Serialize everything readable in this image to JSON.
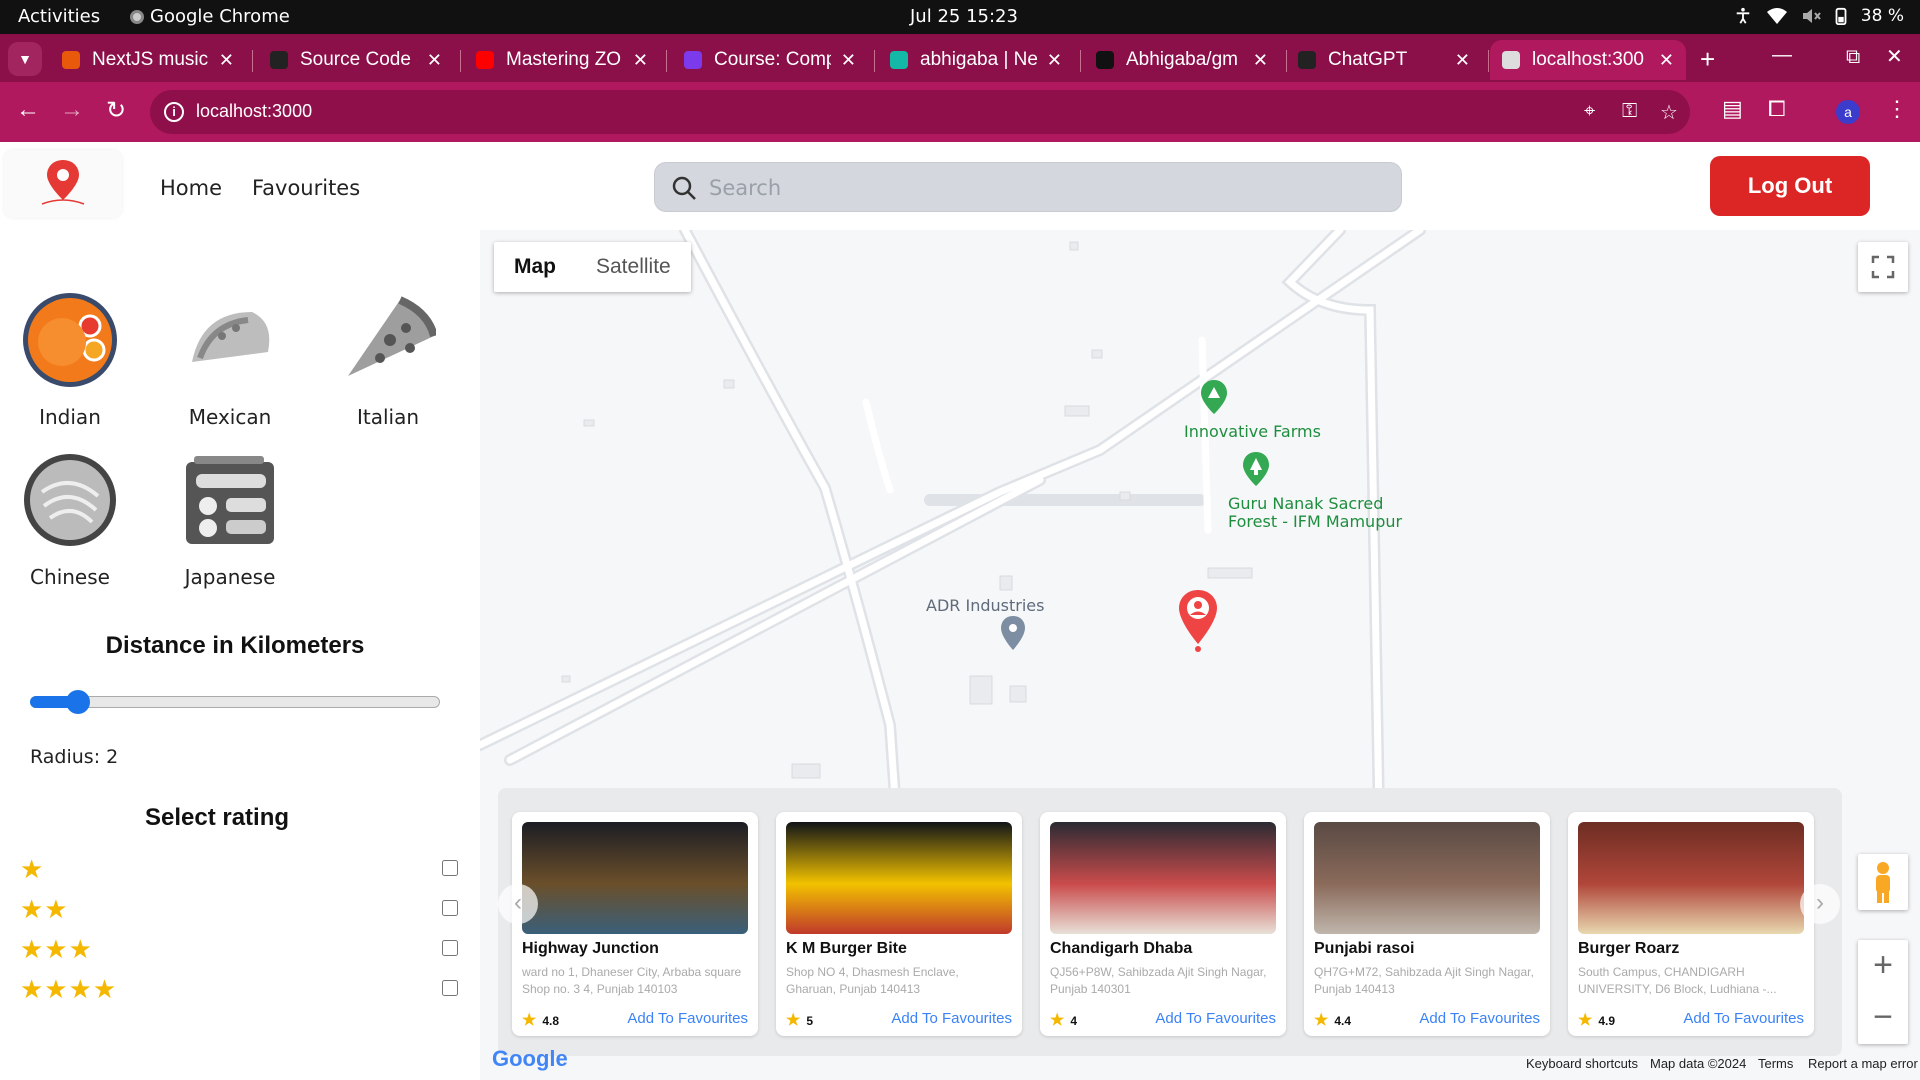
{
  "os": {
    "activities": "Activities",
    "app_name": "Google Chrome",
    "clock": "Jul 25  15:23",
    "battery": "38 %"
  },
  "tabs": [
    {
      "title": "NextJS music",
      "icon_color": "#e8590c"
    },
    {
      "title": "Source Code -",
      "icon_color": "#222222"
    },
    {
      "title": "Mastering ZO",
      "icon_color": "#ff0000"
    },
    {
      "title": "Course: Comp",
      "icon_color": "#7c3aed"
    },
    {
      "title": "abhigaba | Ne",
      "icon_color": "#14b8a6"
    },
    {
      "title": "Abhigaba/gm",
      "icon_color": "#111111"
    },
    {
      "title": "ChatGPT",
      "icon_color": "#222222"
    },
    {
      "title": "localhost:300",
      "icon_color": "#dddddd",
      "active": true
    }
  ],
  "address_bar": {
    "url": "localhost:3000"
  },
  "header": {
    "nav": [
      "Home",
      "Favourites"
    ],
    "search_placeholder": "Search",
    "logout_label": "Log Out"
  },
  "sidebar": {
    "categories": [
      "Indian",
      "Mexican",
      "Italian",
      "Chinese",
      "Japanese"
    ],
    "distance_title": "Distance in Kilometers",
    "radius_label": "Radius: 2",
    "radius_value": 2,
    "rating_title": "Select rating",
    "rating_options": [
      {
        "stars": "★",
        "checked": false
      },
      {
        "stars": "★★",
        "checked": false
      },
      {
        "stars": "★★★",
        "checked": false
      },
      {
        "stars": "★★★★",
        "checked": false
      }
    ]
  },
  "map": {
    "type_map": "Map",
    "type_satellite": "Satellite",
    "labels": {
      "farms": "Innovative Farms",
      "forest_line1": "Guru Nanak Sacred",
      "forest_line2": "Forest - IFM Mamupur",
      "industries": "ADR Industries"
    },
    "google": "Google",
    "footer": {
      "shortcuts": "Keyboard shortcuts",
      "data": "Map data ©2024",
      "terms": "Terms",
      "report": "Report a map error"
    }
  },
  "restaurants": [
    {
      "name": "Highway Junction",
      "address": "ward no 1, Dhaneser City, Arbaba square Shop no. 3 4, Punjab 140103",
      "rating": "4.8",
      "fav_label": "Add To Favourites"
    },
    {
      "name": "K M Burger Bite",
      "address": "Shop NO 4, Dhasmesh Enclave, Gharuan, Punjab 140413",
      "rating": "5",
      "fav_label": "Add To Favourites"
    },
    {
      "name": "Chandigarh Dhaba",
      "address": "QJ56+P8W, Sahibzada Ajit Singh Nagar, Punjab 140301",
      "rating": "4",
      "fav_label": "Add To Favourites"
    },
    {
      "name": "Punjabi rasoi",
      "address": "QH7G+M72, Sahibzada Ajit Singh Nagar, Punjab 140413",
      "rating": "4.4",
      "fav_label": "Add To Favourites"
    },
    {
      "name": "Burger Roarz",
      "address": "South Campus, CHANDIGARH UNIVERSITY, D6 Block, Ludhiana -...",
      "rating": "4.9",
      "fav_label": "Add To Favourites"
    }
  ],
  "colors": {
    "accent": "#b0195e",
    "logout": "#dc2626",
    "link": "#3b82f6",
    "star": "#f5b800"
  }
}
